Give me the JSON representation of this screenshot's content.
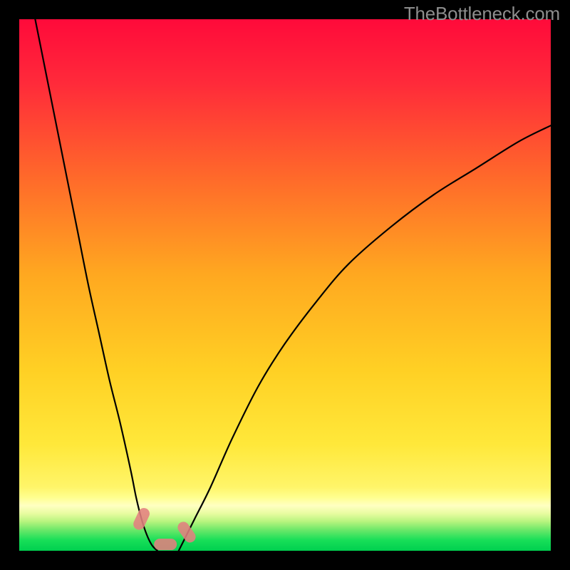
{
  "watermark": "TheBottleneck.com",
  "chart_data": {
    "type": "line",
    "title": "",
    "xlabel": "",
    "ylabel": "",
    "xlim": [
      0,
      100
    ],
    "ylim": [
      0,
      100
    ],
    "grid": false,
    "background_gradient": [
      "#ff0033",
      "#ff7a00",
      "#ffd800",
      "#ffff66",
      "#00e85a"
    ],
    "series": [
      {
        "name": "left-curve",
        "x": [
          3,
          5,
          7,
          9,
          11,
          13,
          15,
          17,
          19,
          21,
          22,
          23,
          24,
          25,
          26
        ],
        "y": [
          100,
          90,
          80,
          70,
          60,
          50,
          41,
          32,
          24,
          15,
          10,
          6,
          3,
          1,
          0
        ]
      },
      {
        "name": "right-curve",
        "x": [
          30,
          31,
          33,
          36,
          40,
          45,
          50,
          56,
          62,
          70,
          78,
          86,
          94,
          100
        ],
        "y": [
          0,
          2,
          6,
          12,
          21,
          31,
          39,
          47,
          54,
          61,
          67,
          72,
          77,
          80
        ]
      }
    ],
    "markers": [
      {
        "name": "left-marker",
        "x": 23.0,
        "y": 6.0,
        "rotation": -65
      },
      {
        "name": "mid-marker",
        "x": 27.5,
        "y": 1.2,
        "rotation": 0
      },
      {
        "name": "right-marker",
        "x": 31.5,
        "y": 3.5,
        "rotation": 55
      }
    ],
    "bottom_band": {
      "start_y": 10,
      "colors": [
        "#ffff99",
        "#d4f57a",
        "#7de86b",
        "#00e85a",
        "#00d24f"
      ]
    }
  }
}
